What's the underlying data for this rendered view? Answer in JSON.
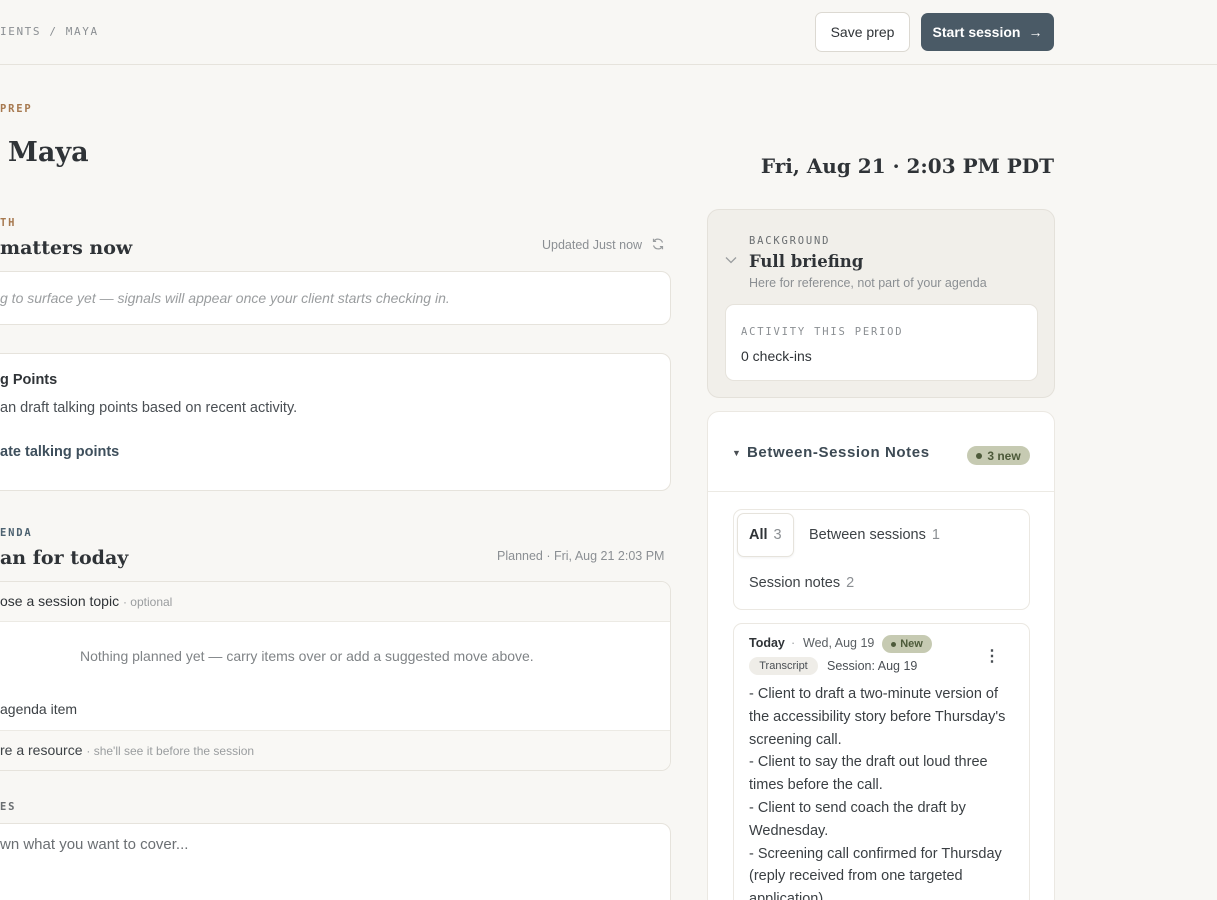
{
  "header": {
    "breadcrumb": "IENTS / MAYA",
    "save_label": "Save prep",
    "start_label": "Start session"
  },
  "page": {
    "eyebrow": "PREP",
    "title": "Maya",
    "datetime": "Fri, Aug 21 · 2:03 PM PDT"
  },
  "signals": {
    "eyebrow": "TH",
    "title": "matters now",
    "updated": "Updated Just now",
    "empty_text": "g to surface yet — signals will appear once your client starts checking in."
  },
  "talking_points": {
    "title": "g Points",
    "description": "an draft talking points based on recent activity.",
    "action": "ate talking points"
  },
  "agenda": {
    "eyebrow": "ENDA",
    "title": "an for today",
    "planned": "Planned · Fri, Aug 21 2:03 PM",
    "topic_label": "ose a session topic",
    "topic_optional": "· optional",
    "empty_text": "Nothing planned yet — carry items over or add a suggested move above.",
    "add_item": "agenda item",
    "share_label": "re a resource",
    "share_sub": "· she'll see it before the session"
  },
  "notes": {
    "eyebrow": "ES",
    "placeholder": "wn what you want to cover..."
  },
  "background": {
    "eyebrow": "BACKGROUND",
    "title": "Full briefing",
    "subtitle": "Here for reference, not part of your agenda",
    "activity_label": "ACTIVITY THIS PERIOD",
    "activity_value": "0 check-ins"
  },
  "between_notes": {
    "title": "Between-Session Notes",
    "new_badge": "3 new",
    "filters": [
      {
        "label": "All",
        "count": "3"
      },
      {
        "label": "Between sessions",
        "count": "1"
      },
      {
        "label": "Session notes",
        "count": "2"
      }
    ],
    "entry": {
      "day": "Today",
      "separator": "·",
      "date": "Wed, Aug 19",
      "badge": "New",
      "tag": "Transcript",
      "session": "Session: Aug 19",
      "lines": [
        "- Client to draft a two-minute version of the accessibility story before Thursday's screening call.",
        "- Client to say the draft out loud three times before the call.",
        "- Client to send coach the draft by Wednesday.",
        "- Screening call confirmed for Thursday (reply received from one targeted application)."
      ]
    }
  },
  "colors": {
    "accent": "#4a5a66",
    "eyebrow_brown": "#a7794f",
    "new_badge_bg": "#c6cab2"
  }
}
